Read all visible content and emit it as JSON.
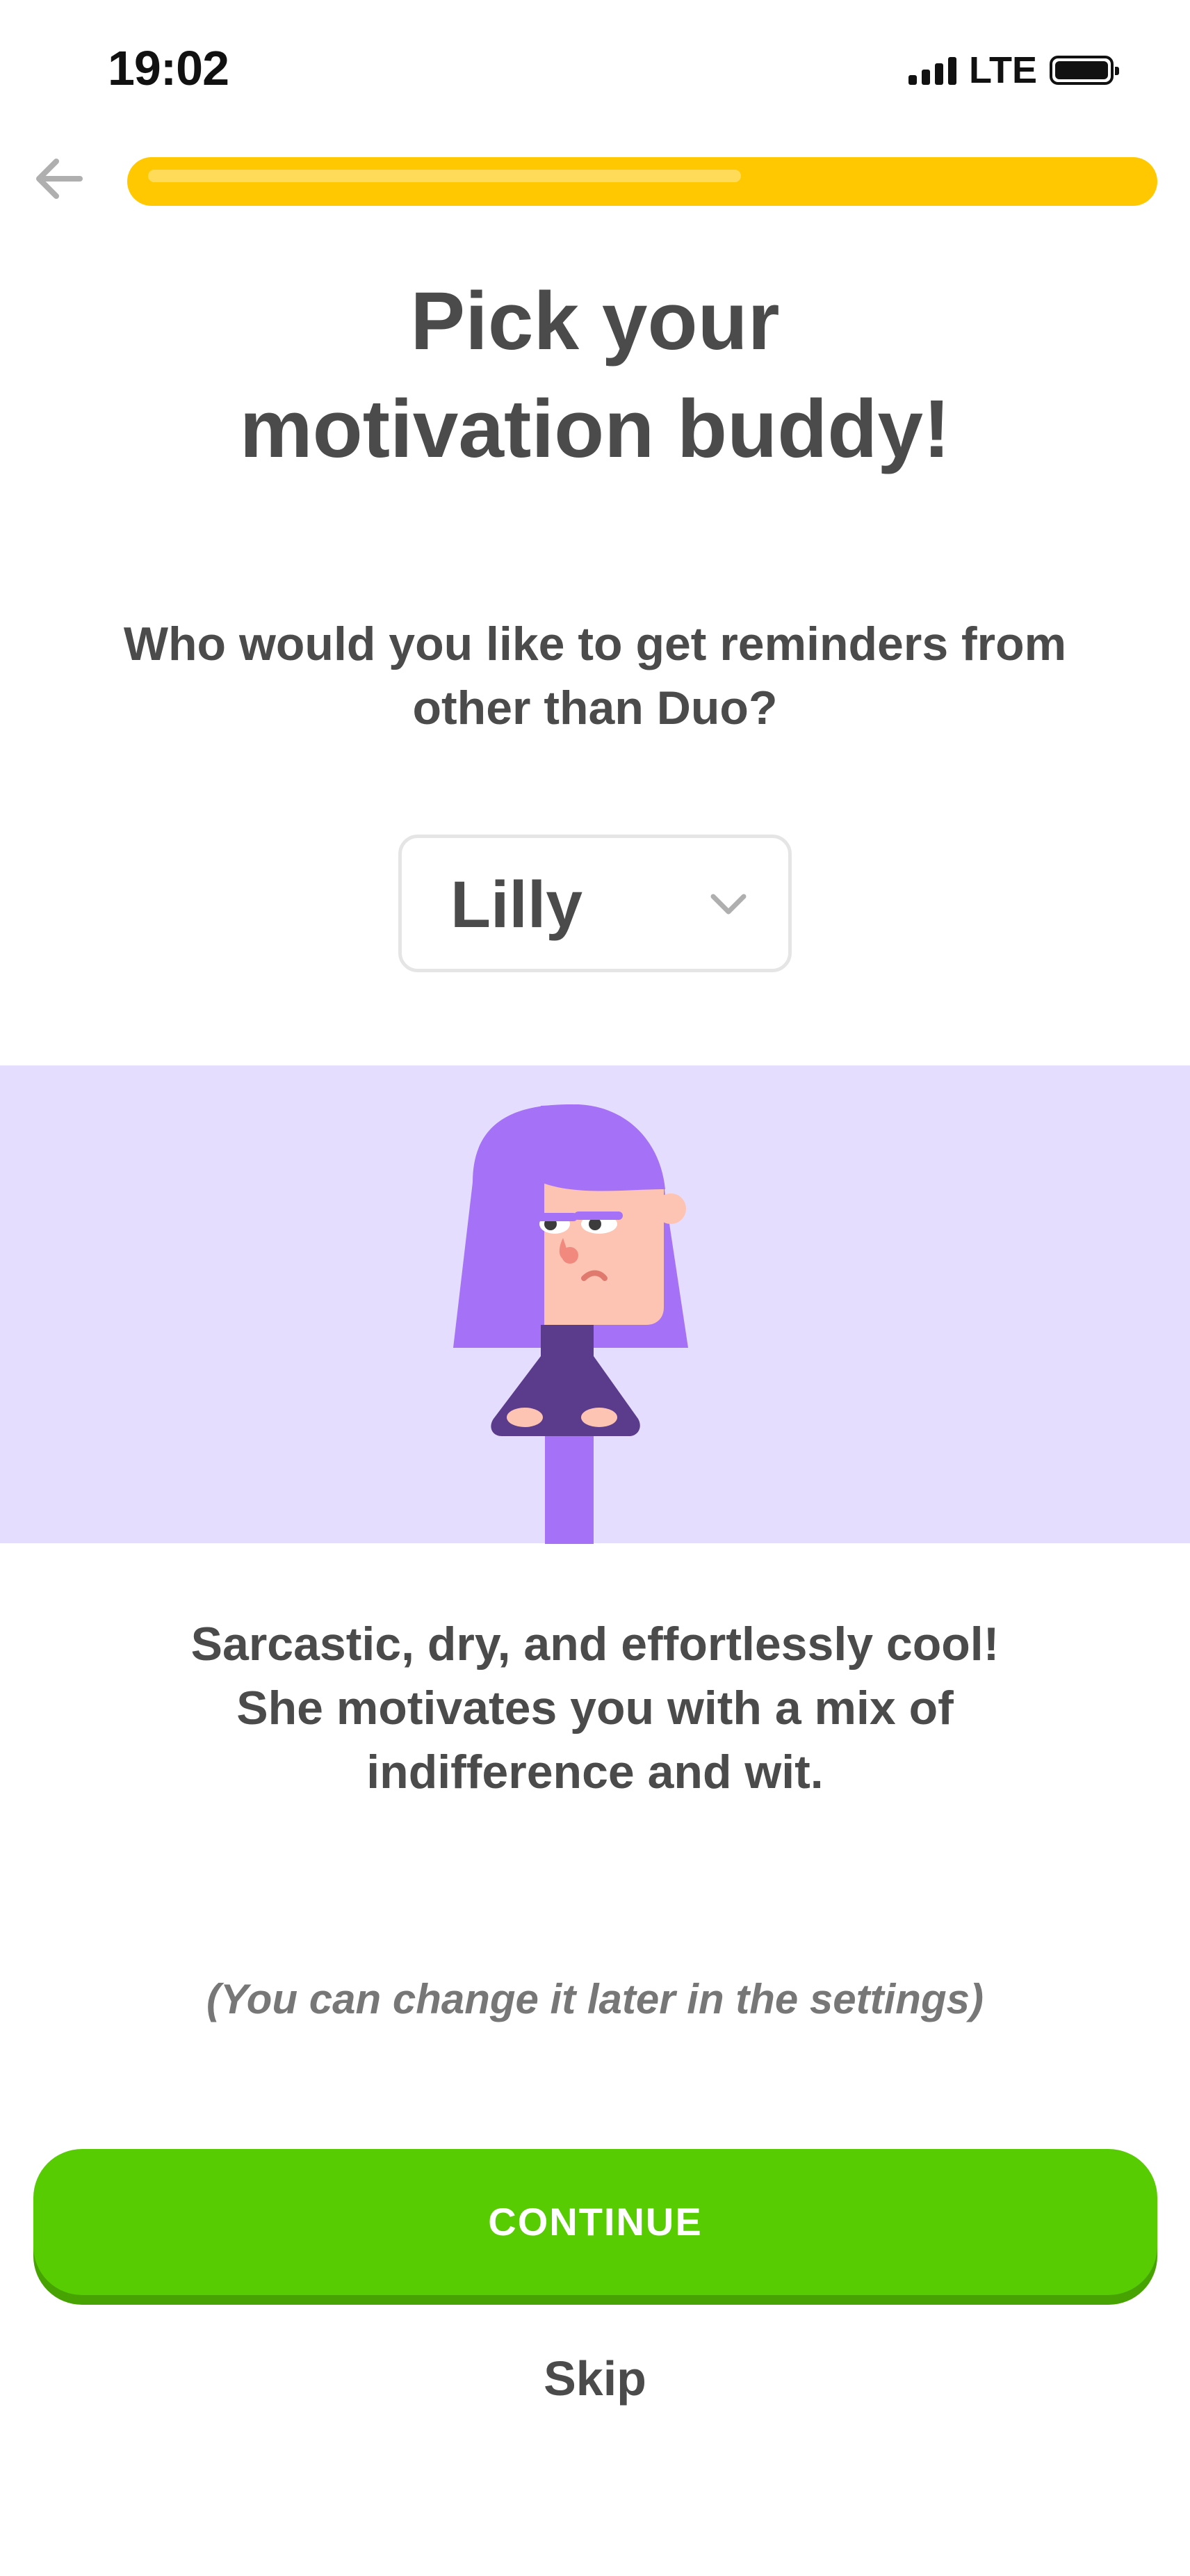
{
  "status_bar": {
    "time": "19:02",
    "network": "LTE"
  },
  "progress": {
    "fraction": 0.6
  },
  "colors": {
    "progress": "#ffc800",
    "continue": "#58cc02",
    "banner": "#e5ddfd",
    "hair": "#a572f7"
  },
  "header": {
    "title_line1": "Pick your",
    "title_line2": "motivation buddy!",
    "subtitle_line1": "Who would you like to get reminders from",
    "subtitle_line2": "other than Duo?"
  },
  "selector": {
    "value": "Lilly",
    "icon": "chevron-down-icon"
  },
  "description": {
    "line1": "Sarcastic, dry, and effortlessly cool!",
    "line2": "She motivates you with a mix of",
    "line3": "indifference and wit."
  },
  "note": "(You can change it later in the settings)",
  "actions": {
    "continue_label": "CONTINUE",
    "skip_label": "Skip"
  }
}
